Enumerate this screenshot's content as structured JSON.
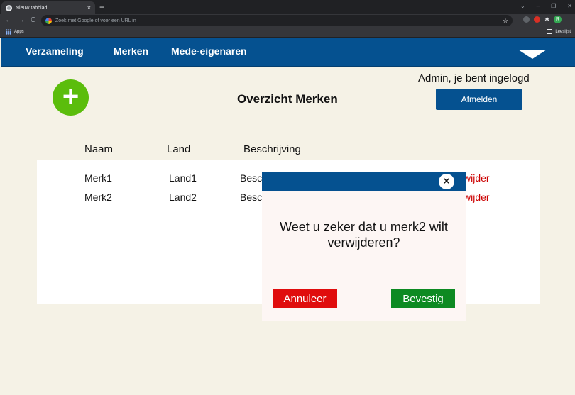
{
  "browser": {
    "tab_title": "Nieuw tabblad",
    "tab_close": "×",
    "new_tab": "+",
    "window_controls": [
      "⌄",
      "–",
      "❐",
      "✕"
    ],
    "back": "←",
    "forward": "→",
    "reload": "C",
    "omnibox_placeholder": "Zoek met Google of voer een URL in",
    "star": "☆",
    "profile_initial": "R",
    "menu": "⋮",
    "puzzle": "✱",
    "bookmarks_apps": "Apps",
    "reading_list": "Leeslijst"
  },
  "nav": {
    "items": [
      {
        "label": "Verzameling"
      },
      {
        "label": "Merken"
      },
      {
        "label": "Mede-eigenaren"
      }
    ]
  },
  "page": {
    "add_symbol": "+",
    "title": "Overzicht Merken",
    "login_status": "Admin, je bent ingelogd",
    "logout_label": "Afmelden"
  },
  "table": {
    "headers": [
      "Naam",
      "Land",
      "Beschrijving"
    ],
    "rows": [
      {
        "naam": "Merk1",
        "land": "Land1",
        "beschrijving": "Besc",
        "actie": "wijder"
      },
      {
        "naam": "Merk2",
        "land": "Land2",
        "beschrijving": "Besc",
        "actie": "wijder"
      }
    ]
  },
  "modal": {
    "close_symbol": "×",
    "message": "Weet u zeker dat u merk2 wilt verwijderen?",
    "cancel_label": "Annuleer",
    "confirm_label": "Bevestig"
  },
  "colors": {
    "brand_blue": "#055190",
    "add_green": "#5bbd0c",
    "cancel_red": "#e00d0d",
    "confirm_green": "#0d8a22",
    "page_bg": "#f5f2e6"
  }
}
